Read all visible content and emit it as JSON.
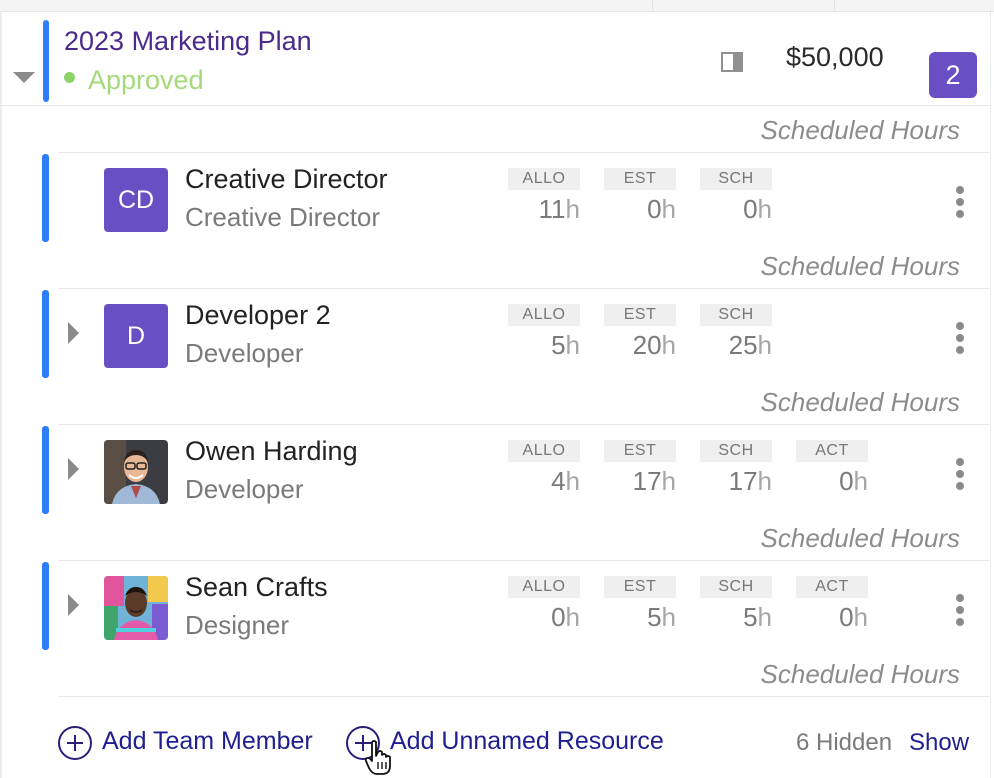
{
  "project": {
    "title": "2023 Marketing Plan",
    "status": "Approved",
    "budget": "$50,000",
    "member_count": "2",
    "colors": {
      "title": "#4a2a8a",
      "status": "#a5d97b",
      "accent_bar": "#2d7ff9",
      "badge": "#6a4fc4"
    }
  },
  "scheduled_hours_label": "Scheduled Hours",
  "metric_labels": {
    "allo": "ALLO",
    "est": "EST",
    "sch": "SCH",
    "act": "ACT"
  },
  "unit": "h",
  "members": [
    {
      "name": "Creative Director",
      "role": "Creative Director",
      "avatar": "CD",
      "avatar_type": "initials",
      "expandable": false,
      "allo": "11",
      "est": "0",
      "sch": "0",
      "act": null
    },
    {
      "name": "Developer 2",
      "role": "Developer",
      "avatar": "D",
      "avatar_type": "initials",
      "expandable": true,
      "allo": "5",
      "est": "20",
      "sch": "25",
      "act": null
    },
    {
      "name": "Owen Harding",
      "role": "Developer",
      "avatar": "photo-man-glasses",
      "avatar_type": "photo",
      "expandable": true,
      "allo": "4",
      "est": "17",
      "sch": "17",
      "act": "0"
    },
    {
      "name": "Sean Crafts",
      "role": "Designer",
      "avatar": "photo-man-colorful",
      "avatar_type": "photo",
      "expandable": true,
      "allo": "0",
      "est": "5",
      "sch": "5",
      "act": "0"
    }
  ],
  "footer": {
    "add_team_member": "Add Team Member",
    "add_unnamed_resource": "Add Unnamed Resource",
    "hidden_count": "6 Hidden",
    "show": "Show"
  },
  "icons": [
    "caret-down-icon",
    "panel-toggle-icon",
    "caret-right-icon",
    "kebab-menu-icon",
    "plus-circle-icon",
    "hand-pointer-cursor"
  ]
}
